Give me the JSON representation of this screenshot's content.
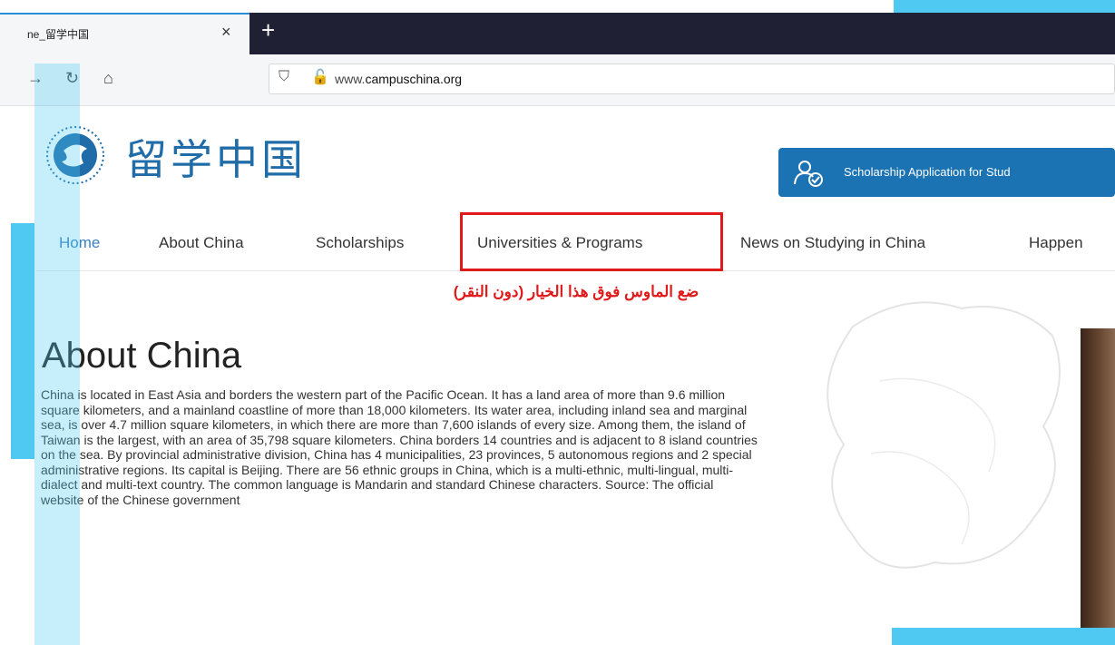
{
  "browser": {
    "tab_title": "ne_留学中国",
    "tab_close": "×",
    "new_tab": "+",
    "url_prefix": "www.",
    "url_domain": "campuschina.org"
  },
  "site": {
    "logo_text": "留学中国",
    "apply_button": "Scholarship Application for Stud"
  },
  "menu": {
    "items": [
      {
        "label": "Home",
        "active": true
      },
      {
        "label": "About China"
      },
      {
        "label": "Scholarships"
      },
      {
        "label": "Universities & Programs"
      },
      {
        "label": "News on Studying in China"
      },
      {
        "label": "Happen"
      }
    ]
  },
  "annotation": {
    "instruction": "ضع الماوس فوق هذا الخيار (دون النقر)",
    "highlight_color": "#e01a1a"
  },
  "content": {
    "title": "About China",
    "body": "China is located in East Asia and borders the western part of the Pacific Ocean. It has a land area of more than 9.6 million square kilometers, and a mainland coastline of more than 18,000 kilometers. Its water area, including inland sea and marginal sea, is over 4.7 million square kilometers, in which there are more than 7,600 islands of every size. Among them, the island of Taiwan is the largest, with an area of 35,798 square kilometers. China borders 14 countries and is adjacent to 8 island countries on the sea. By provincial administrative division, China has 4 municipalities, 23 provinces, 5 autonomous regions and 2 special administrative regions. Its capital is Beijing. There are 56 ethnic groups in China, which is a multi-ethnic, multi-lingual, multi-dialect and multi-text country. The common language is Mandarin and standard Chinese characters. Source: The official website of the Chinese government"
  },
  "colors": {
    "accent": "#1b73b4",
    "frame": "#4fc9f2",
    "active_menu": "#3a7fc0"
  }
}
